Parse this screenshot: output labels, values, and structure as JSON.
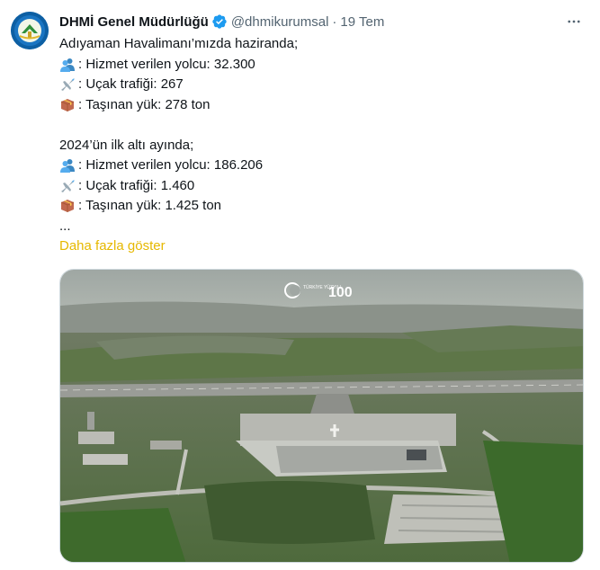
{
  "author": {
    "display_name": "DHMİ Genel Müdürlüğü",
    "handle": "@dhmikurumsal",
    "separator": "·",
    "timestamp": "19 Tem",
    "avatar_icon": "dhmi-logo",
    "verified_icon": "verified-badge-icon",
    "verified_color": "#1d9bf0"
  },
  "tweet": {
    "intro": "Adıyaman Havalimanı’mızda haziranda;",
    "june": [
      {
        "icon": "people-emoji",
        "text": ": Hizmet verilen yolcu: 32.300"
      },
      {
        "icon": "airplane-emoji",
        "text": ": Uçak trafiği: 267"
      },
      {
        "icon": "package-emoji",
        "text": ": Taşınan yük: 278 ton"
      }
    ],
    "half_year_title": "2024’ün ilk altı ayında;",
    "half_year": [
      {
        "icon": "people-emoji",
        "text": ": Hizmet verilen yolcu: 186.206"
      },
      {
        "icon": "airplane-emoji",
        "text": ": Uçak trafiği: 1.460"
      },
      {
        "icon": "package-emoji",
        "text": ": Taşınan yük: 1.425 ton"
      }
    ],
    "ellipsis": "...",
    "show_more": "Daha fazla göster",
    "show_more_color": "#e6b800"
  },
  "media": {
    "watermark_left": "TÜRKİYE YÜZYILI",
    "watermark_right": "100"
  }
}
